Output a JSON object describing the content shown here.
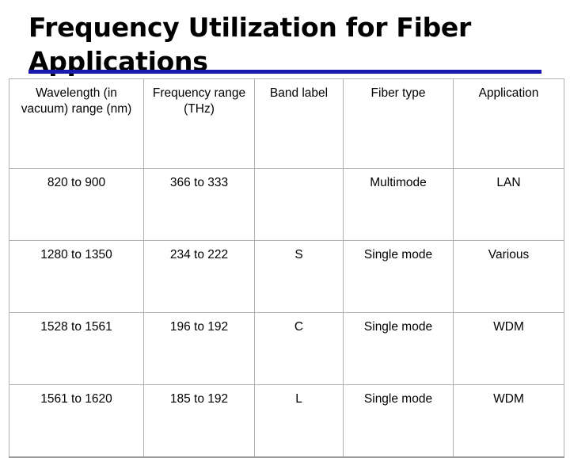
{
  "slide": {
    "title": "Frequency Utilization for Fiber Applications",
    "accent_color": "#1a1aaf",
    "border_color": "#b0b0b0",
    "text_color": "#000000",
    "background_color": "#ffffff"
  },
  "table": {
    "headers": [
      "Wavelength (in vacuum) range (nm)",
      "Frequency range (THz)",
      "Band label",
      "Fiber type",
      "Application"
    ],
    "header_alignment": [
      "center",
      "center",
      "left",
      "center",
      "center"
    ],
    "rows": [
      {
        "wavelength_range_nm": "820 to 900",
        "frequency_range_thz": "366 to 333",
        "band_label": "",
        "fiber_type": "Multimode",
        "application": "LAN"
      },
      {
        "wavelength_range_nm": "1280 to 1350",
        "frequency_range_thz": "234 to 222",
        "band_label": "S",
        "fiber_type": "Single mode",
        "application": "Various"
      },
      {
        "wavelength_range_nm": "1528 to 1561",
        "frequency_range_thz": "196 to 192",
        "band_label": "C",
        "fiber_type": "Single mode",
        "application": "WDM"
      },
      {
        "wavelength_range_nm": "1561 to 1620",
        "frequency_range_thz": "185 to 192",
        "band_label": "L",
        "fiber_type": "Single mode",
        "application": "WDM"
      }
    ]
  }
}
